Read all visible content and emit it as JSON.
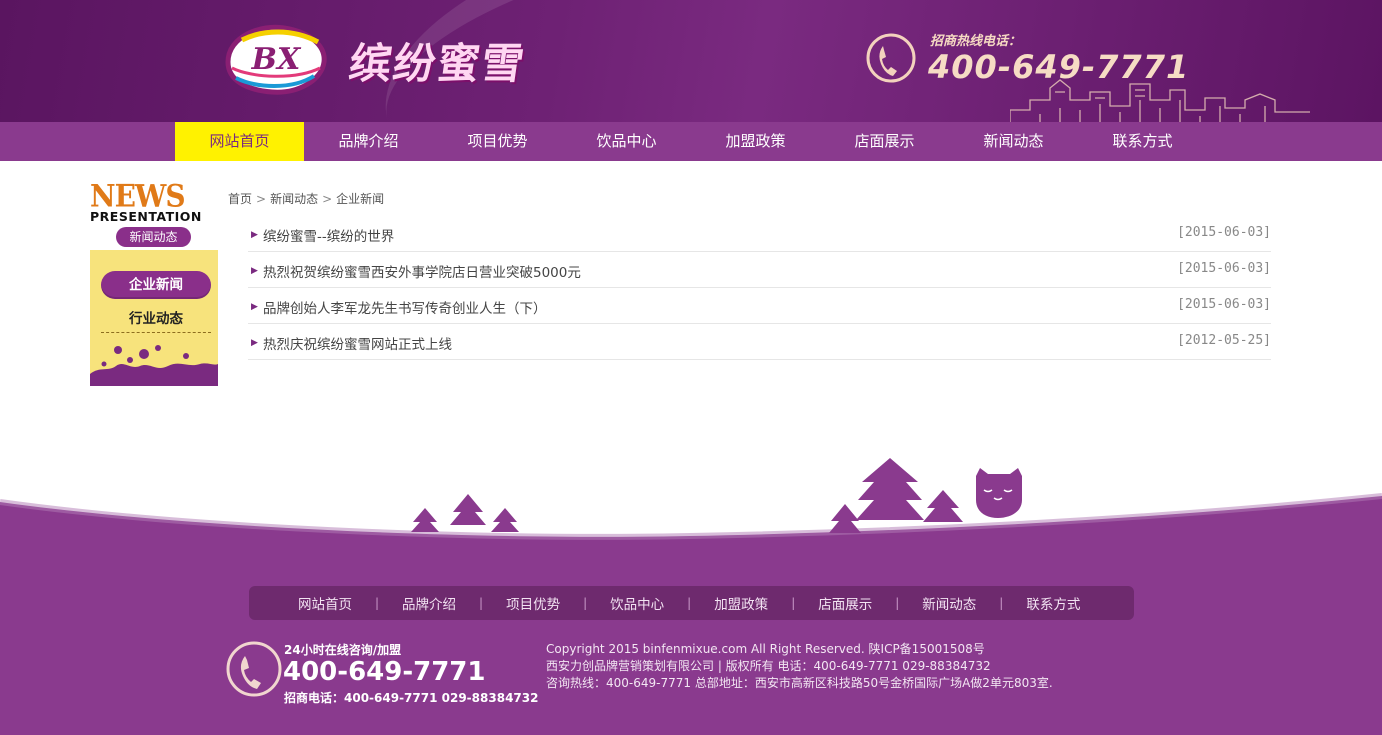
{
  "header": {
    "logo_badge_text": "BX",
    "brand_name": "缤纷蜜雪",
    "hotline_label": "招商热线电话：",
    "hotline_number": "400-649-7771"
  },
  "nav": {
    "items": [
      "网站首页",
      "品牌介绍",
      "项目优势",
      "饮品中心",
      "加盟政策",
      "店面展示",
      "新闻动态",
      "联系方式"
    ],
    "active_index": 0
  },
  "sidebar": {
    "heading_en": "NEWS",
    "heading_sub": "PRESENTATION",
    "section_tag": "新闻动态",
    "items": [
      "企业新闻",
      "行业动态"
    ],
    "active_index": 0
  },
  "breadcrumb": {
    "items": [
      "首页",
      "新闻动态",
      "企业新闻"
    ],
    "separator": ">"
  },
  "news_list": [
    {
      "title": "缤纷蜜雪--缤纷的世界",
      "date": "[2015-06-03]"
    },
    {
      "title": "热烈祝贺缤纷蜜雪西安外事学院店日营业突破5000元",
      "date": "[2015-06-03]"
    },
    {
      "title": "品牌创始人李军龙先生书写传奇创业人生（下）",
      "date": "[2015-06-03]"
    },
    {
      "title": "热烈庆祝缤纷蜜雪网站正式上线",
      "date": "[2012-05-25]"
    }
  ],
  "footer": {
    "nav_items": [
      "网站首页",
      "品牌介绍",
      "项目优势",
      "饮品中心",
      "加盟政策",
      "店面展示",
      "新闻动态",
      "联系方式"
    ],
    "divider": "|",
    "consult_label": "24小时在线咨询/加盟",
    "consult_number": "400-649-7771",
    "recruit_line": "招商电话：400-649-7771 029-88384732",
    "copyright_lines": [
      "Copyright 2015 binfenmixue.com All Right Reserved. 陕ICP备15001508号",
      "西安力创品牌营销策划有限公司 | 版权所有 电话：400-649-7771 029-88384732",
      "咨询热线：400-649-7771 总部地址：西安市高新区科技路50号金桥国际广场A做2单元803室."
    ]
  },
  "colors": {
    "brand_purple": "#7a2a80",
    "nav_purple": "#8a3a8e",
    "active_yellow": "#fff200",
    "sidebar_yellow": "#f7e37c",
    "footer_purple": "#8a3a8e"
  }
}
